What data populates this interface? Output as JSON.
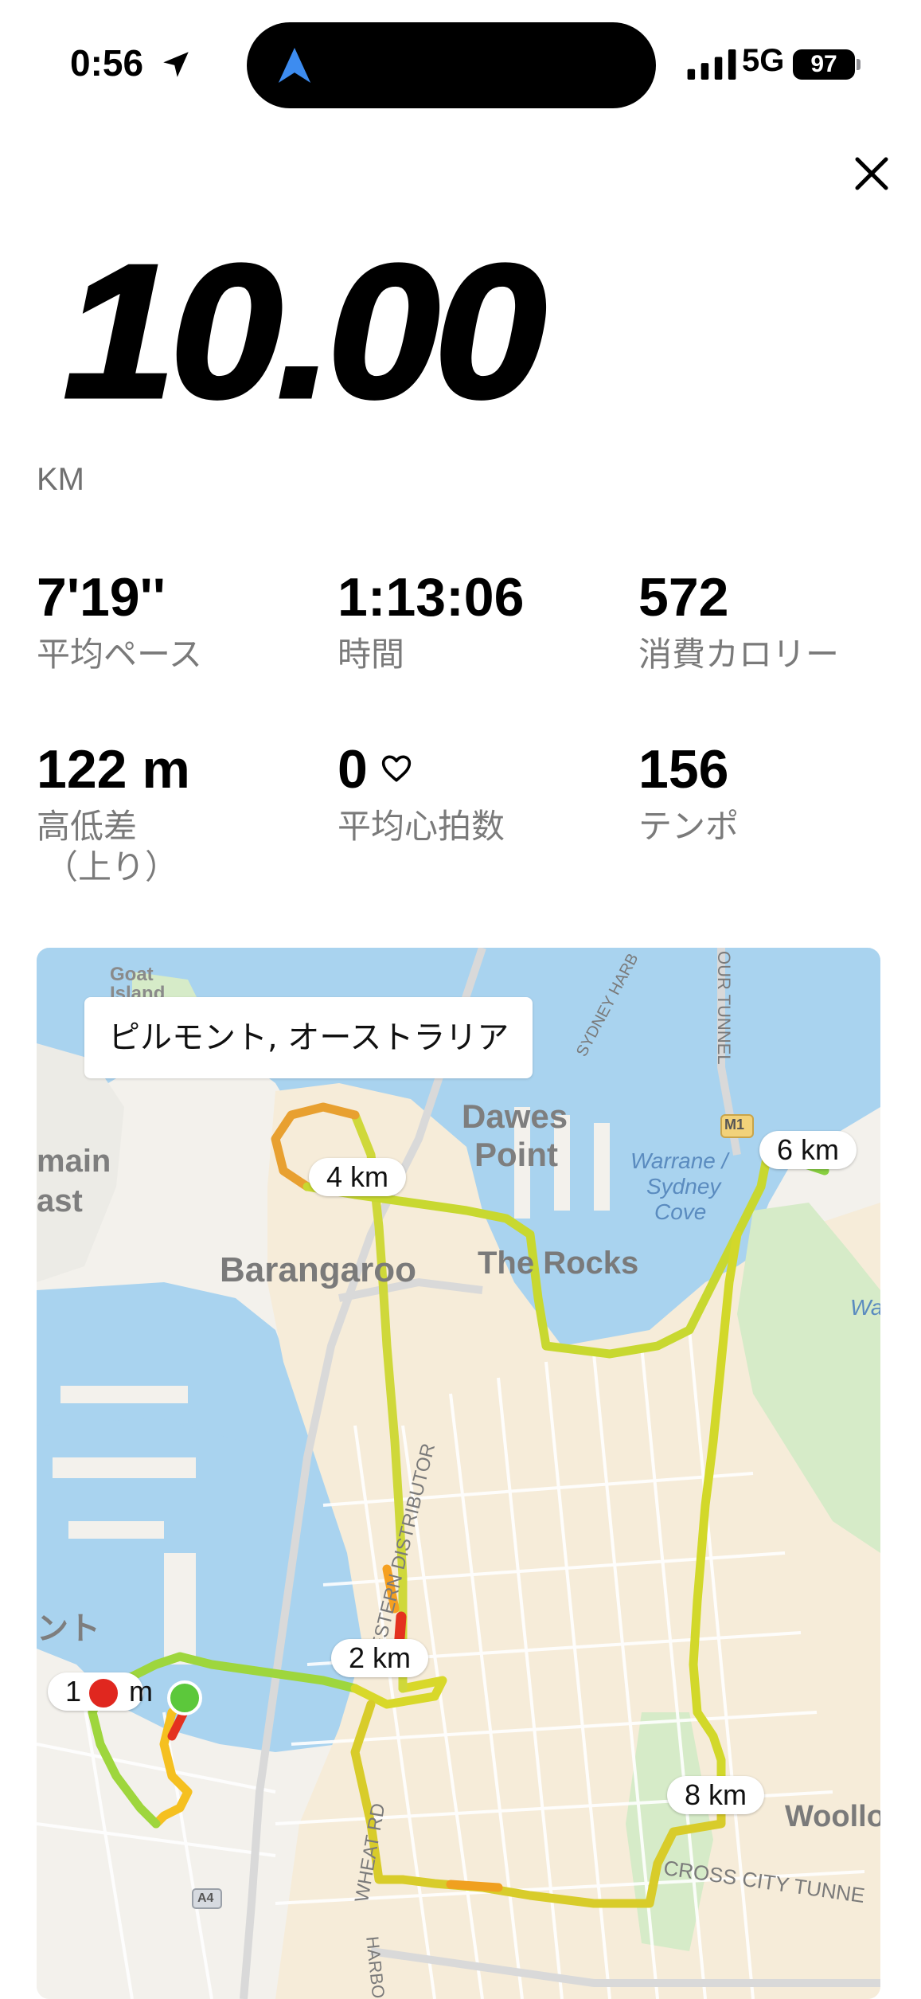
{
  "status": {
    "time": "0:56",
    "network": "5G",
    "battery": "97",
    "icons": [
      "location-arrow-icon",
      "navigation-icon",
      "signal-icon"
    ]
  },
  "summary": {
    "distance": "10.00",
    "unit": "KM"
  },
  "stats": [
    {
      "value": "7'19''",
      "label": "平均ペース"
    },
    {
      "value": "1:13:06",
      "label": "時間"
    },
    {
      "value": "572",
      "label": "消費カロリー"
    },
    {
      "value": "122 m",
      "label": "高低差",
      "label2": "（上り）"
    },
    {
      "value": "0",
      "label": "平均心拍数",
      "icon": "heart-outline-icon"
    },
    {
      "value": "156",
      "label": "テンポ"
    }
  ],
  "map": {
    "location": "ピルモント, オーストラリア",
    "km_markers": [
      "1",
      "m",
      "2 km",
      "4 km",
      "6 km",
      "8 km"
    ],
    "labels": {
      "goat": "Goat",
      "island": "Island",
      "main": "main",
      "ast": "ast",
      "dawes": "Dawes",
      "point": "Point",
      "barangaroo": "Barangaroo",
      "rocks": "The Rocks",
      "warrane": "Warrane /",
      "sydney": "Sydney",
      "cove": "Cove",
      "wahg": "Wahg",
      "woollo": "Woollo",
      "cross_city": "CROSS CITY TUNNE",
      "wheat": "WHEAT RD",
      "western": "WESTERN DISTRIBUTOR",
      "harbour": "SYDNEY HARB",
      "tunnel": "OUR TUNNEL",
      "harbo": "HARBO",
      "nto": "ント",
      "m1": "M1",
      "a4": "A4"
    },
    "colors": {
      "water": "#a9d3ef",
      "land": "#f3f1ec",
      "park": "#d6ebc8",
      "start": "#5cc83b",
      "end": "#e0271f"
    }
  }
}
